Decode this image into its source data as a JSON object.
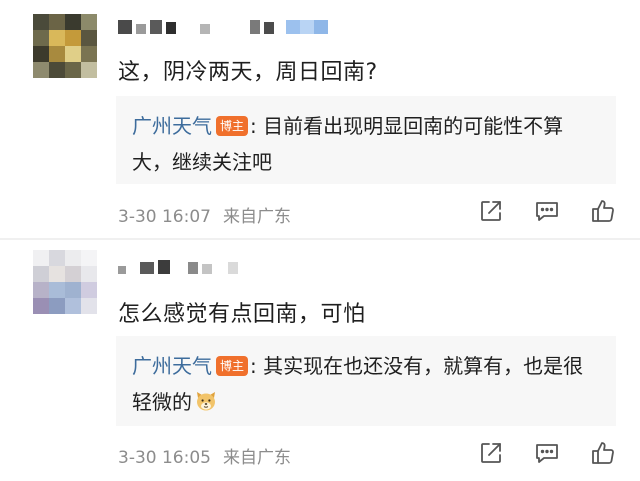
{
  "comments": [
    {
      "text": "这，阴冷两天，周日回南?",
      "reply": {
        "author": "广州天气",
        "badge": "博主",
        "text": ": 目前看出现明显回南的可能性不算大，继续关注吧"
      },
      "time": "3-30 16:07",
      "location": "来自广东"
    },
    {
      "text": "怎么感觉有点回南，可怕",
      "reply": {
        "author": "广州天气",
        "badge": "博主",
        "text": ": 其实现在也还没有，就算有，也是很轻微的"
      },
      "time": "3-30 16:05",
      "location": "来自广东"
    }
  ],
  "icons": {
    "share": "share-icon",
    "reply": "comment-icon",
    "like": "thumbs-up-icon",
    "emoji": "doge-emoji-icon"
  },
  "colors": {
    "author": "#3d6c9c",
    "badge": "#f0702c",
    "reply_bg": "#f7f7f7",
    "meta": "#8c8c8c"
  }
}
